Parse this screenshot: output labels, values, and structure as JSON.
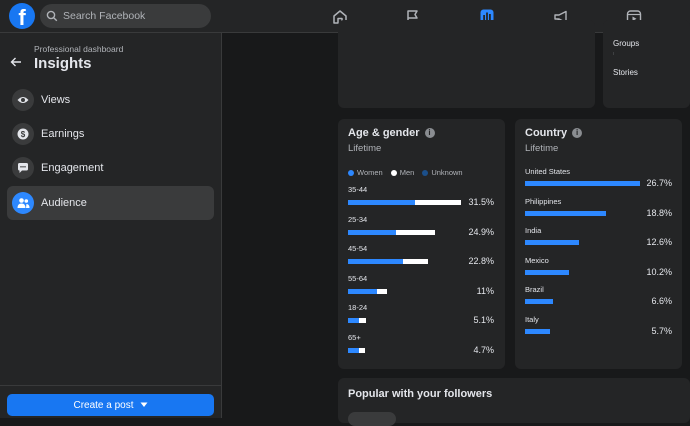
{
  "header": {
    "search_placeholder": "Search Facebook",
    "logo_letter": "f"
  },
  "nav": [
    "home-icon",
    "flag-icon",
    "insights-icon",
    "megaphone-icon",
    "video-icon"
  ],
  "sidebar": {
    "section": "Professional dashboard",
    "title": "Insights",
    "items": [
      {
        "label": "Views",
        "icon": "eye-icon"
      },
      {
        "label": "Earnings",
        "icon": "dollar-icon"
      },
      {
        "label": "Engagement",
        "icon": "chat-icon"
      },
      {
        "label": "Audience",
        "icon": "people-icon",
        "active": true
      }
    ],
    "create_post": "Create a post"
  },
  "top_right": {
    "groups": "Groups",
    "stories": "Stories"
  },
  "age_gender": {
    "title": "Age & gender",
    "subtitle": "Lifetime",
    "legend": {
      "women": "Women",
      "men": "Men",
      "unknown": "Unknown"
    },
    "rows": [
      {
        "label": "35-44",
        "pct": "31.5%",
        "women": 0.19,
        "men": 0.13
      },
      {
        "label": "25-34",
        "pct": "24.9%",
        "women": 0.135,
        "men": 0.11
      },
      {
        "label": "45-54",
        "pct": "22.8%",
        "women": 0.156,
        "men": 0.072
      },
      {
        "label": "55-64",
        "pct": "11%",
        "women": 0.083,
        "men": 0.027
      },
      {
        "label": "18-24",
        "pct": "5.1%",
        "women": 0.03,
        "men": 0.021
      },
      {
        "label": "65+",
        "pct": "4.7%",
        "women": 0.03,
        "men": 0.017
      }
    ]
  },
  "country": {
    "title": "Country",
    "subtitle": "Lifetime",
    "rows": [
      {
        "label": "United States",
        "pct": "26.7%",
        "value": 0.267
      },
      {
        "label": "Philippines",
        "pct": "18.8%",
        "value": 0.188
      },
      {
        "label": "India",
        "pct": "12.6%",
        "value": 0.126
      },
      {
        "label": "Mexico",
        "pct": "10.2%",
        "value": 0.102
      },
      {
        "label": "Brazil",
        "pct": "6.6%",
        "value": 0.066
      },
      {
        "label": "Italy",
        "pct": "5.7%",
        "value": 0.057
      }
    ]
  },
  "popular": {
    "title": "Popular with your followers"
  },
  "colors": {
    "women": "#2d88ff",
    "men": "#ffffff",
    "unknown": "#1b4f8a"
  }
}
